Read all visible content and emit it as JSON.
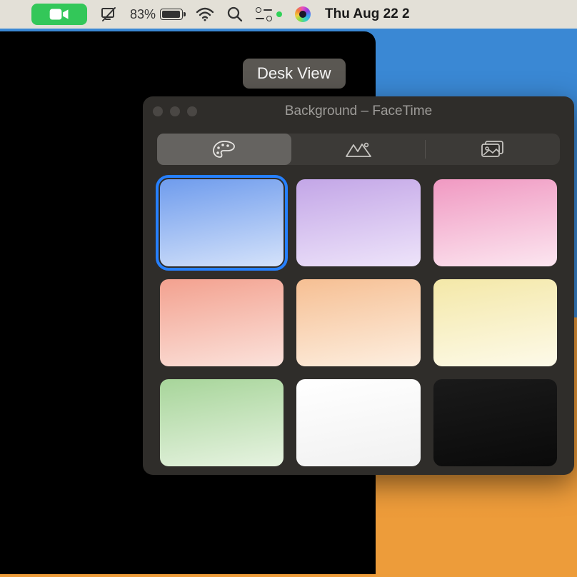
{
  "menubar": {
    "facetime_indicator": "facetime-active",
    "screen_share": "screen-share-icon",
    "battery_percent": "83%",
    "wifi": "wifi-icon",
    "spotlight": "search-icon",
    "control_center": "control-center-icon",
    "siri": "siri-icon",
    "clock": "Thu Aug 22  2"
  },
  "desk_view_label": "Desk View",
  "panel": {
    "title": "Background – FaceTime",
    "tabs": [
      {
        "name": "colors",
        "icon": "palette-icon",
        "active": true
      },
      {
        "name": "landscapes",
        "icon": "mountain-icon",
        "active": false
      },
      {
        "name": "photos",
        "icon": "photo-gallery-icon",
        "active": false
      }
    ],
    "swatches": [
      {
        "name": "blue-gradient",
        "selected": true
      },
      {
        "name": "purple-gradient",
        "selected": false
      },
      {
        "name": "pink-gradient",
        "selected": false
      },
      {
        "name": "coral-gradient",
        "selected": false
      },
      {
        "name": "orange-gradient",
        "selected": false
      },
      {
        "name": "yellow-gradient",
        "selected": false
      },
      {
        "name": "green-gradient",
        "selected": false
      },
      {
        "name": "white-gradient",
        "selected": false
      },
      {
        "name": "black-gradient",
        "selected": false
      }
    ]
  }
}
